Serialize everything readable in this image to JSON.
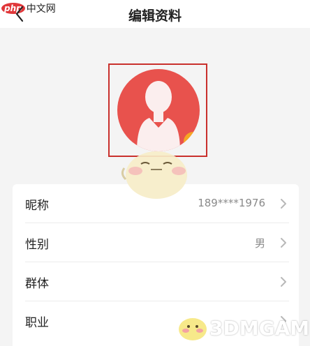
{
  "watermark_top": {
    "logo": "php",
    "text": "中文网"
  },
  "header": {
    "title": "编辑资料"
  },
  "profile": {
    "avatar": "person-silhouette-icon",
    "camera_icon": "camera-icon",
    "avatar_bg": "#e8524d",
    "camera_bg": "#f5a623"
  },
  "fields": [
    {
      "label": "昵称",
      "value": "189****1976"
    },
    {
      "label": "性别",
      "value": "男"
    },
    {
      "label": "群体",
      "value": ""
    },
    {
      "label": "职业",
      "value": ""
    }
  ],
  "watermark_bottom": {
    "text": "3DMGAME"
  }
}
